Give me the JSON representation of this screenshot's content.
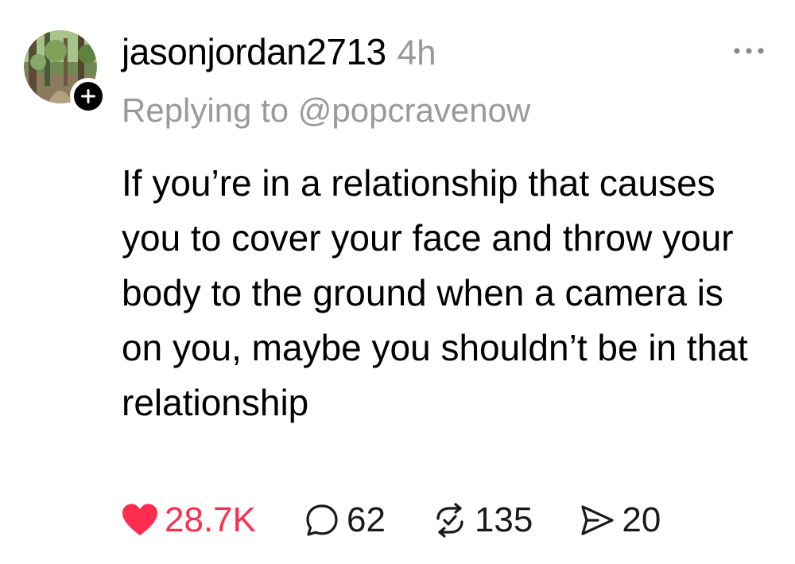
{
  "post": {
    "username": "jasonjordan2713",
    "timestamp": "4h",
    "replying_to": "Replying to @popcravenow",
    "text": "If you’re in a relationship that causes you to cover your face and throw your body to the ground when a camera is on you, maybe you shouldn’t be in that relationship",
    "icons": {
      "avatar": "forest-photo-avatar",
      "follow": "plus-icon",
      "more": "more-horizontal-icon",
      "like": "heart-icon",
      "reply": "comment-bubble-icon",
      "repost": "repost-icon",
      "share": "send-icon"
    }
  },
  "actions": {
    "likes": "28.7K",
    "replies": "62",
    "reposts": "135",
    "shares": "20"
  },
  "colors": {
    "like_active": "#ff2d4f",
    "secondary_text": "#9a9a9a",
    "primary_text": "#000000"
  }
}
